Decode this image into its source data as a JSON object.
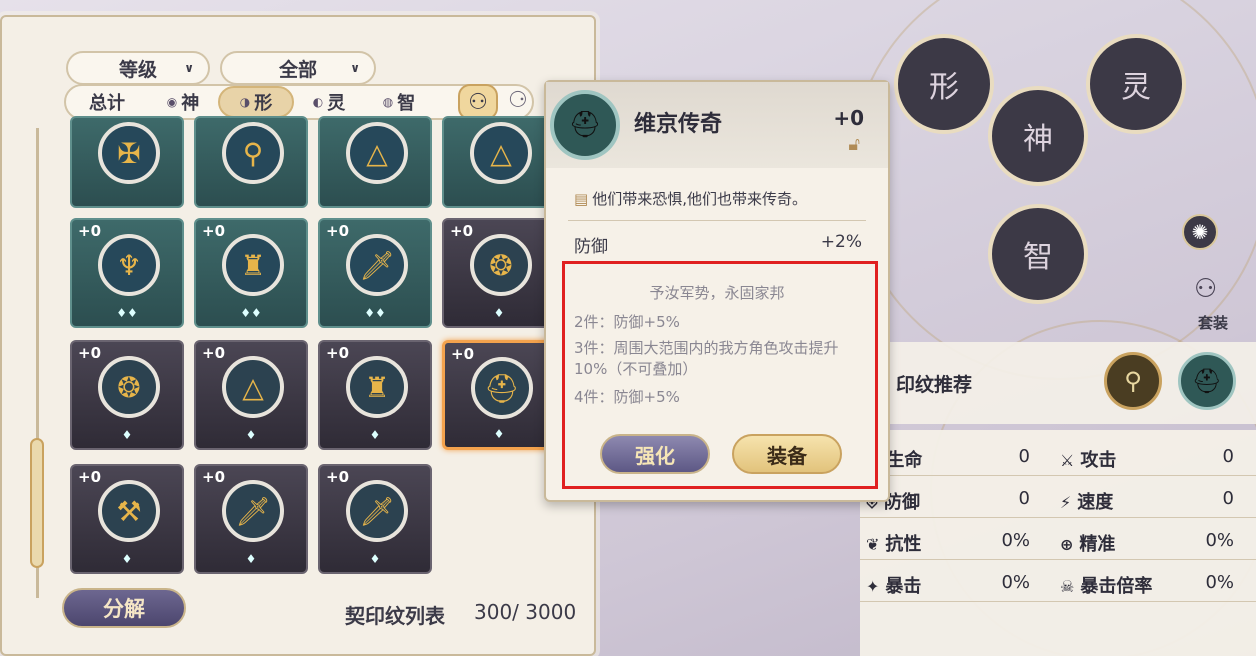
{
  "filters": {
    "sort_label": "等级",
    "category_label": "全部",
    "caret": "∨"
  },
  "tabs": [
    {
      "label": "总计",
      "icon": ""
    },
    {
      "label": "神",
      "icon": "◉"
    },
    {
      "label": "形",
      "icon": "◑"
    },
    {
      "label": "灵",
      "icon": "◐"
    },
    {
      "label": "智",
      "icon": "◍"
    }
  ],
  "active_tab": "形",
  "grid": {
    "rows": [
      [
        {
          "level": "",
          "style": "teal"
        },
        {
          "level": "",
          "style": "teal"
        },
        {
          "level": "",
          "style": "teal"
        },
        {
          "level": "",
          "style": "teal"
        }
      ],
      [
        {
          "level": "+0",
          "style": "teal",
          "stars": "♦♦"
        },
        {
          "level": "+0",
          "style": "teal",
          "stars": "♦♦"
        },
        {
          "level": "+0",
          "style": "teal",
          "stars": "♦♦"
        },
        {
          "level": "+0",
          "style": "dark",
          "stars": "♦"
        }
      ],
      [
        {
          "level": "+0",
          "style": "dark",
          "stars": "♦"
        },
        {
          "level": "+0",
          "style": "dark",
          "stars": "♦"
        },
        {
          "level": "+0",
          "style": "dark",
          "stars": "♦"
        },
        {
          "level": "+0",
          "style": "dark",
          "stars": "♦",
          "selected": true
        }
      ],
      [
        {
          "level": "+0",
          "style": "dark",
          "stars": "♦"
        },
        {
          "level": "+0",
          "style": "dark",
          "stars": "♦"
        },
        {
          "level": "+0",
          "style": "dark",
          "stars": "♦"
        }
      ]
    ]
  },
  "footer": {
    "decompose_label": "分解",
    "list_label": "契印纹列表",
    "count": "300/ 3000"
  },
  "popup": {
    "name": "维京传奇",
    "level": "+0",
    "quote": "他们带来恐惧,他们也带来传奇。",
    "stat_name": "防御",
    "stat_value": "+2%",
    "set_name": "予汝军势，永固家邦",
    "effects": [
      "2件：防御+5%",
      "3件：周围大范围内的我方角色攻击提升10%（不可叠加）",
      "4件：防御+5%"
    ],
    "strengthen_label": "强化",
    "equip_label": "装备"
  },
  "wheel": {
    "xing": "形",
    "ling": "灵",
    "shen": "神",
    "zhi": "智"
  },
  "suit_label": "套装",
  "recommend_title": "印纹推荐",
  "stats": [
    {
      "label": "生命",
      "value": "0",
      "label2": "攻击",
      "value2": "0"
    },
    {
      "label": "防御",
      "value": "0",
      "label2": "速度",
      "value2": "0"
    },
    {
      "label": "抗性",
      "value": "0%",
      "label2": "精准",
      "value2": "0%"
    },
    {
      "label": "暴击",
      "value": "0%",
      "label2": "暴击倍率",
      "value2": "0%"
    }
  ],
  "colors": {
    "highlight": "#e02020",
    "selected_border": "#f3a24d",
    "panel_bg": "#f4efe6"
  }
}
